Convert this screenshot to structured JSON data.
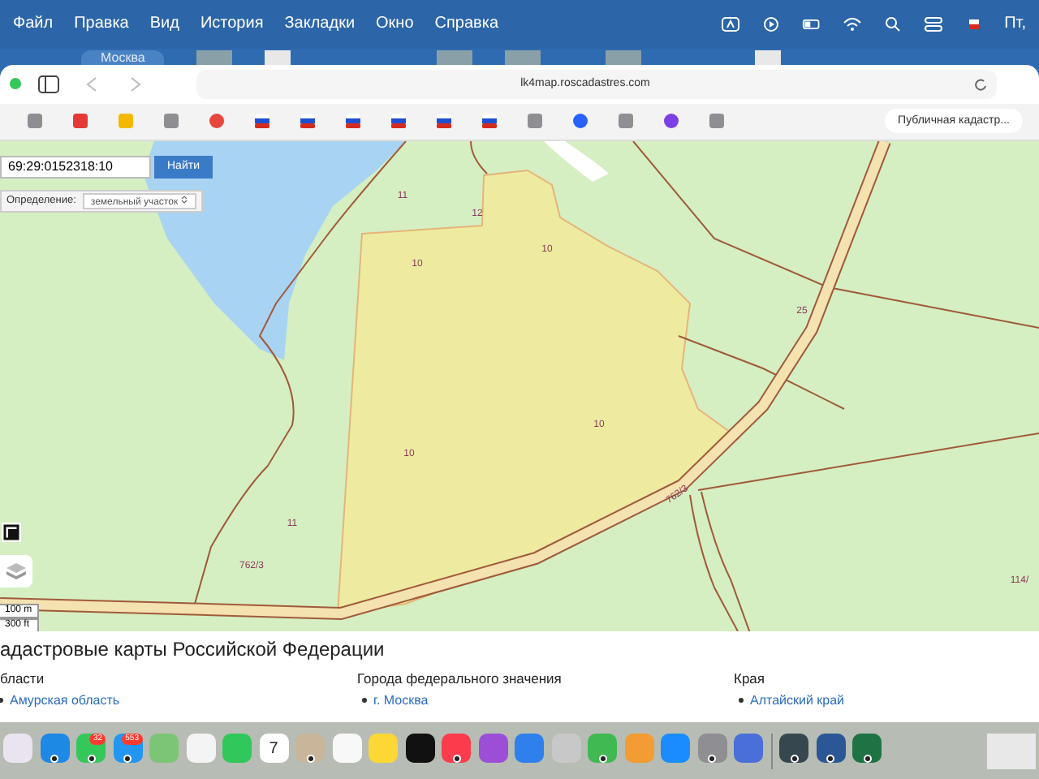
{
  "menu_bar": {
    "items": [
      "Файл",
      "Правка",
      "Вид",
      "История",
      "Закладки",
      "Окно",
      "Справка"
    ],
    "clock": "Пт,"
  },
  "desktop": {
    "widget": "Москва"
  },
  "browser": {
    "address": "lk4map.roscadastres.com",
    "tab": "Публичная кадастр...",
    "favorites": [
      {
        "kind": "tile",
        "color": "#8e8e93"
      },
      {
        "kind": "tile",
        "color": "#e53935"
      },
      {
        "kind": "tile",
        "color": "#f5b800"
      },
      {
        "kind": "tile",
        "color": "#8e8e93"
      },
      {
        "kind": "round",
        "color": "#e8453c"
      },
      {
        "kind": "flag",
        "color": "#1f4fd1"
      },
      {
        "kind": "flag",
        "color": "#1f4fd1"
      },
      {
        "kind": "flag",
        "color": "#1f4fd1"
      },
      {
        "kind": "flag",
        "color": "#1f4fd1"
      },
      {
        "kind": "flag",
        "color": "#1f4fd1"
      },
      {
        "kind": "flag",
        "color": "#1f4fd1"
      },
      {
        "kind": "tile",
        "color": "#8e8e93"
      },
      {
        "kind": "round",
        "color": "#2962ff"
      },
      {
        "kind": "tile",
        "color": "#8e8e93"
      },
      {
        "kind": "round",
        "color": "#7b3fe4"
      },
      {
        "kind": "tile",
        "color": "#8e8e93"
      }
    ]
  },
  "map": {
    "search": {
      "value": "69:29:0152318:10",
      "button": "Найти"
    },
    "definition": {
      "label": "Определение:",
      "value": "земельный участок"
    },
    "labels": [
      "11",
      "12",
      "10",
      "10",
      "10",
      "10",
      "11",
      "25",
      "762/3",
      "762/3",
      "114/"
    ],
    "scale": [
      "100 m",
      "300 ft"
    ]
  },
  "page": {
    "title": "адастровые карты Российской Федерации",
    "columns": [
      {
        "heading": "бласти",
        "links": [
          "Амурская область"
        ]
      },
      {
        "heading": "Города федерального значения",
        "links": [
          "г. Москва"
        ]
      },
      {
        "heading": "Края",
        "links": [
          "Алтайский край"
        ]
      }
    ]
  },
  "dock": {
    "apps": [
      {
        "kind": "app",
        "color": "#e9e4f0",
        "running": false
      },
      {
        "kind": "app",
        "color": "#1e88e5",
        "running": true
      },
      {
        "kind": "app",
        "color": "#34c759",
        "running": true,
        "badge": "32"
      },
      {
        "kind": "app",
        "color": "#2196f3",
        "running": true,
        "badge": "553"
      },
      {
        "kind": "app",
        "color": "#7cc576",
        "running": false
      },
      {
        "kind": "app",
        "color": "#f4f4f4",
        "running": false
      },
      {
        "kind": "app",
        "color": "#30c85a",
        "running": false
      },
      {
        "kind": "calendar",
        "day": "7",
        "running": false
      },
      {
        "kind": "app",
        "color": "#c8b59a",
        "running": true
      },
      {
        "kind": "app",
        "color": "#f8f8f8",
        "running": false
      },
      {
        "kind": "app",
        "color": "#fdd835",
        "running": false
      },
      {
        "kind": "app",
        "color": "#111111",
        "running": false
      },
      {
        "kind": "app",
        "color": "#fa3c4c",
        "running": true
      },
      {
        "kind": "app",
        "color": "#9c4fd6",
        "running": false
      },
      {
        "kind": "app",
        "color": "#2f80ed",
        "running": false
      },
      {
        "kind": "app",
        "color": "#c8c8c8",
        "running": false
      },
      {
        "kind": "app",
        "color": "#3fb950",
        "running": true
      },
      {
        "kind": "app",
        "color": "#f39c33",
        "running": false
      },
      {
        "kind": "app",
        "color": "#1a8cff",
        "running": false
      },
      {
        "kind": "app",
        "color": "#8e8e93",
        "running": true
      },
      {
        "kind": "app",
        "color": "#4a6fd8",
        "running": false
      },
      {
        "kind": "app",
        "color": "#37474f",
        "running": true
      },
      {
        "kind": "app",
        "color": "#2b5797",
        "running": true
      },
      {
        "kind": "app",
        "color": "#1f7244",
        "running": true
      }
    ]
  }
}
